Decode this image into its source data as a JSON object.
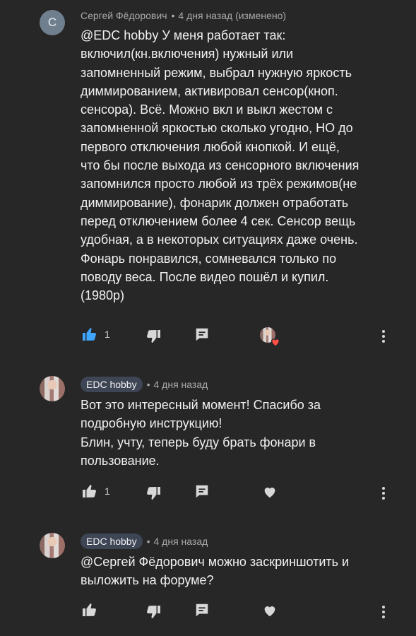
{
  "comments": [
    {
      "avatar_letter": "С",
      "author": "Сергей Фёдорович",
      "time": "4 дня назад (изменено)",
      "text": "@EDC hobby У меня работает так:\nвключил(кн.включения) нужный или\nзапомненный режим, выбрал нужную яркость\nдиммированием, активировал сенсор(кноп.\nсенсора). Всё. Можно вкл и выкл жестом с\nзапомненной яркостью сколько угодно, НО до\nпервого отключения любой кнопкой. И ещё,\nчто бы после выхода из сенсорного включения\nзапомнился просто любой из трёх режимов(не\nдиммирование), фонарик должен отработать\nперед отключением более 4 сек.  Сенсор вещь\nудобная, а в некоторых ситуациях даже очень.\nФонарь понравился, сомневался только по\nповоду веса. После видео пошёл и купил.\n(1980р)",
      "likes": "1",
      "liked": true,
      "creator_hearted": true
    },
    {
      "author": "EDC hobby",
      "time": "4 дня назад",
      "text": "Вот это интересный момент! Спасибо за\nподробную инструкцию!\nБлин, учту, теперь буду брать фонари в\nпользование.",
      "likes": "1",
      "liked": false,
      "creator_hearted": false
    },
    {
      "author": "EDC hobby",
      "time": "4 дня назад",
      "text": "@Сергей Фёдорович можно заскриншотить и\nвыложить на форуме?",
      "likes": "",
      "liked": false,
      "creator_hearted": false
    }
  ],
  "icons": {
    "like": "thumb-up-icon",
    "dislike": "thumb-down-icon",
    "reply": "reply-icon",
    "heart": "heart-icon",
    "more": "more-vert-icon"
  },
  "colors": {
    "background": "#272727",
    "text": "#f1f1f1",
    "muted": "#aaaaaa",
    "liked_blue": "#3ea6ff",
    "heart_red": "#ff4e45",
    "badge_bg": "#3e4656"
  }
}
